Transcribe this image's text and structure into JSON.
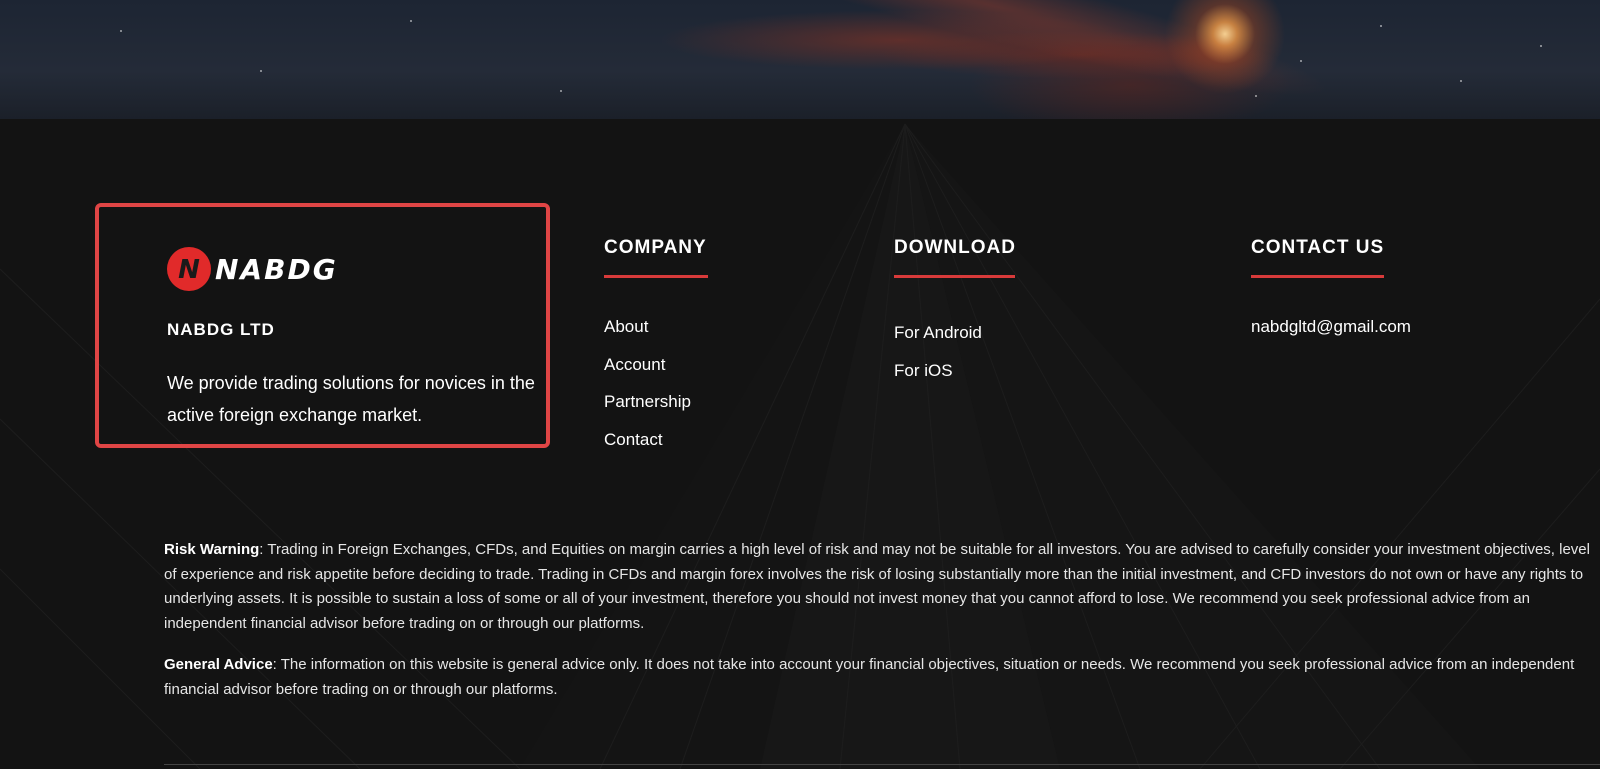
{
  "brand": {
    "logo_text": "NABDG",
    "logo_mark": "N",
    "company_name": "NABDG LTD",
    "description": "We provide trading solutions for novices in the active foreign exchange market."
  },
  "company": {
    "title": "COMPANY",
    "links": [
      "About",
      "Account",
      "Partnership",
      "Contact"
    ]
  },
  "download": {
    "title": "DOWNLOAD",
    "links": [
      "For Android",
      "For iOS"
    ]
  },
  "contact": {
    "title": "CONTACT US",
    "email": "nabdgltd@gmail.com"
  },
  "legal": {
    "risk_label": "Risk Warning",
    "risk_text": ": Trading in Foreign Exchanges, CFDs, and Equities on margin carries a high level of risk and may not be suitable for all investors. You are advised to carefully consider your investment objectives, level of experience and risk appetite before deciding to trade. Trading in CFDs and margin forex involves the risk of losing substantially more than the initial investment, and CFD investors do not own or have any rights to underlying assets. It is possible to sustain a loss of some or all of your investment, therefore you should not invest money that you cannot afford to lose. We recommend you seek professional advice from an independent financial advisor before trading on or through our platforms.",
    "advice_label": "General Advice",
    "advice_text": ": The information on this website is general advice only. It does not take into account your financial objectives, situation or needs. We recommend you seek professional advice from an independent financial advisor before trading on or through our platforms."
  },
  "colors": {
    "accent": "#e04545",
    "background": "#131313",
    "logo_red": "#e12a2a"
  },
  "icons": {
    "logo": "nabdg-logo-icon"
  }
}
